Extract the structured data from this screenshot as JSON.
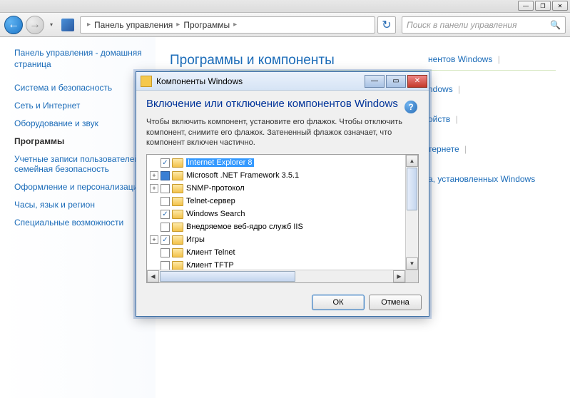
{
  "titlebar": {
    "min": "—",
    "max": "❐",
    "close": "✕"
  },
  "nav": {
    "back": "←",
    "forward": "→",
    "drop": "▾",
    "breadcrumb": {
      "item1": "Панель управления",
      "item2": "Программы",
      "sep": "▸"
    },
    "refresh": "↻",
    "search_placeholder": "Поиск в панели управления",
    "search_icon": "🔍"
  },
  "sidebar": {
    "home": "Панель управления - домашняя страница",
    "items": [
      "Система и безопасность",
      "Сеть и Интернет",
      "Оборудование и звук",
      "Программы",
      "Учетные записи пользователей и семейная безопасность",
      "Оформление и персонализация",
      "Часы, язык и регион",
      "Специальные возможности"
    ],
    "active_index": 3
  },
  "content": {
    "heading": "Программы и компоненты",
    "right_links": {
      "a": "нентов Windows",
      "b": "ndows",
      "c": "ойств",
      "d": "тернете",
      "e": "а, установленных Windows"
    }
  },
  "dialog": {
    "title": "Компоненты Windows",
    "heading": "Включение или отключение компонентов Windows",
    "help": "?",
    "description": "Чтобы включить компонент, установите его флажок. Чтобы отключить компонент, снимите его флажок. Затененный флажок означает, что компонент включен частично.",
    "tree": [
      {
        "expand": "",
        "check": "checked",
        "label": "Internet Explorer 8",
        "selected": true
      },
      {
        "expand": "+",
        "check": "filled",
        "label": "Microsoft .NET Framework 3.5.1"
      },
      {
        "expand": "+",
        "check": "",
        "label": "SNMP-протокол",
        "cursor": true
      },
      {
        "expand": "",
        "check": "",
        "label": "Telnet-сервер"
      },
      {
        "expand": "",
        "check": "checked",
        "label": "Windows Search"
      },
      {
        "expand": "",
        "check": "",
        "label": "Внедряемое веб-ядро служб IIS"
      },
      {
        "expand": "+",
        "check": "checked",
        "label": "Игры"
      },
      {
        "expand": "",
        "check": "",
        "label": "Клиент Telnet"
      },
      {
        "expand": "",
        "check": "",
        "label": "Клиент TFTP"
      }
    ],
    "buttons": {
      "ok": "ОК",
      "cancel": "Отмена"
    }
  }
}
